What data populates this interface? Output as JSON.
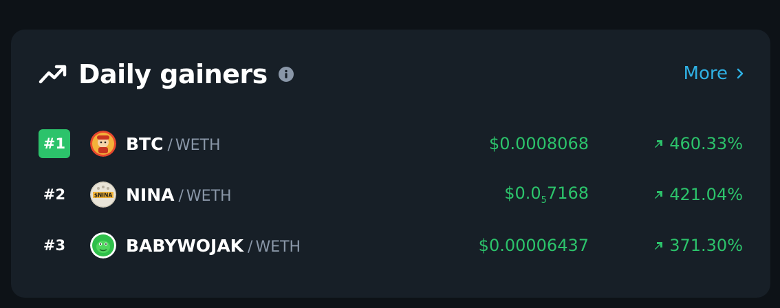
{
  "header": {
    "title": "Daily gainers",
    "icon": "trending-up-icon",
    "info_icon": "info-icon",
    "more_label": "More"
  },
  "colors": {
    "background": "#0d1217",
    "card": "#171f27",
    "accent_green": "#2cc36b",
    "link_blue": "#2fb0e3",
    "muted_text": "#8a97a8"
  },
  "gainers": [
    {
      "rank": "#1",
      "base": "BTC",
      "separator": "/",
      "quote": "WETH",
      "price_prefix": "$0.0008068",
      "price_sub": "",
      "price_suffix": "",
      "change": "460.33%",
      "avatar": "btc-token-avatar"
    },
    {
      "rank": "#2",
      "base": "NINA",
      "separator": "/",
      "quote": "WETH",
      "price_prefix": "$0.0",
      "price_sub": "5",
      "price_suffix": "7168",
      "change": "421.04%",
      "avatar": "nina-token-avatar"
    },
    {
      "rank": "#3",
      "base": "BABYWOJAK",
      "separator": "/",
      "quote": "WETH",
      "price_prefix": "$0.00006437",
      "price_sub": "",
      "price_suffix": "",
      "change": "371.30%",
      "avatar": "babywojak-token-avatar"
    }
  ]
}
